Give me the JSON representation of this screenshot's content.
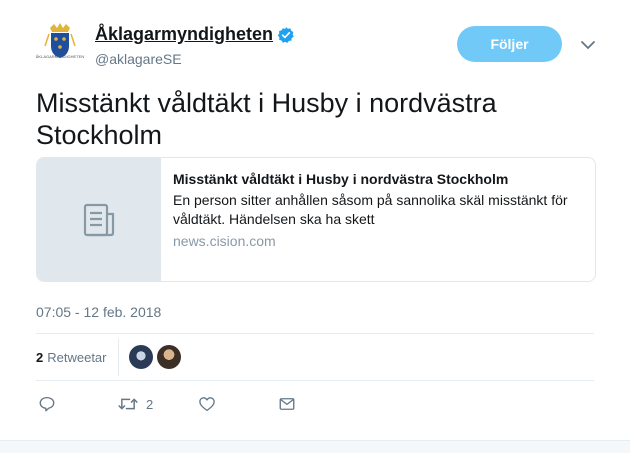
{
  "account": {
    "name": "Åklagarmyndigheten",
    "handle": "@aklagareSE",
    "avatar_text": "ÅKLAGARMYNDIGHETEN",
    "verified_icon": "verified-badge-icon"
  },
  "follow_button": {
    "label": "Följer"
  },
  "tweet": {
    "text": "Misstänkt våldtäkt i Husby i nordvästra Stockholm"
  },
  "card": {
    "title": "Misstänkt våldtäkt i Husby i nordvästra Stockholm",
    "description": "En person sitter anhållen såsom på sannolika skäl misstänkt för våldtäkt. Händelsen ska ha skett",
    "domain": "news.cision.com",
    "thumb_icon": "document-icon"
  },
  "timestamp": "07:05 - 12 feb. 2018",
  "stats": {
    "retweet_count": "2",
    "retweet_label": "Retweetar"
  },
  "actions": {
    "reply_icon": "reply-icon",
    "retweet_icon": "retweet-icon",
    "retweet_count": "2",
    "like_icon": "heart-icon",
    "dm_icon": "envelope-icon"
  },
  "colors": {
    "follow_bg": "#71c9f8",
    "verified": "#1da1f2",
    "muted": "#657786"
  }
}
